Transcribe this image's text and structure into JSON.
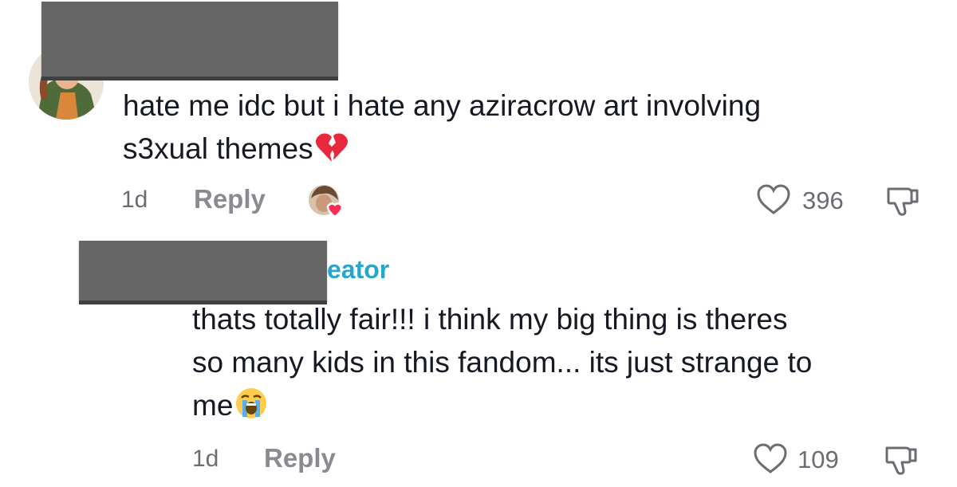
{
  "comments": [
    {
      "text_lines": [
        "hate me idc but i hate any aziracrow art involving",
        "s3xual themes"
      ],
      "emoji": "broken-heart-icon",
      "time": "1d",
      "reply_label": "Reply",
      "likes": "396"
    },
    {
      "creator_tag": "eator",
      "text_lines": [
        "thats totally fair!!! i think my big thing is theres",
        "so many kids in this fandom... its just strange to",
        "me"
      ],
      "emoji": "loudly-crying-face-icon",
      "time": "1d",
      "reply_label": "Reply",
      "likes": "109"
    }
  ],
  "colors": {
    "text": "#161823",
    "meta": "#6c6c72",
    "reply": "#8a8b91",
    "creator": "#29a7c9",
    "redaction": "#666666",
    "heart_badge": "#fe2c55"
  }
}
